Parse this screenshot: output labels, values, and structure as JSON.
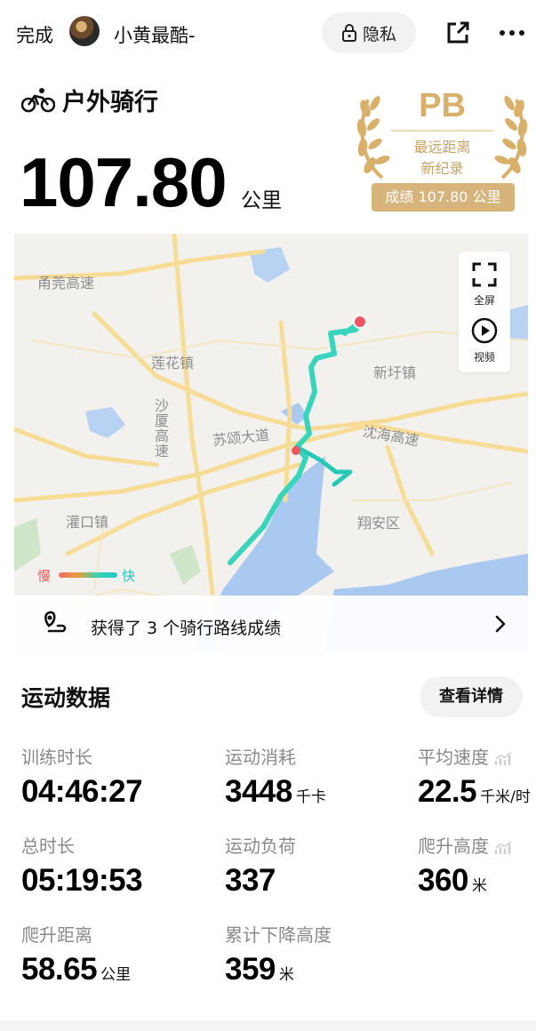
{
  "header": {
    "done_label": "完成",
    "username": "小黄最酷-",
    "privacy_label": "隐私",
    "share_icon": "share-icon",
    "more_icon": "more-icon"
  },
  "activity": {
    "sport_type": "户外骑行",
    "distance_value": "107.80",
    "distance_unit": "公里"
  },
  "pb_badge": {
    "title": "PB",
    "line1": "最远距离",
    "line2": "新纪录",
    "result": "成绩 107.80 公里",
    "color": "#d7b47c"
  },
  "map": {
    "labels": [
      "甬莞高速",
      "莲花镇",
      "新圩镇",
      "沙厦高速",
      "苏颂大道",
      "沈海高速",
      "灌口镇",
      "翔安区"
    ],
    "fullscreen_label": "全屏",
    "video_label": "视频",
    "legend_slow": "慢",
    "legend_fast": "快",
    "route_achievement": "获得了 3 个骑行路线成绩"
  },
  "stats": {
    "section_title": "运动数据",
    "details_button": "查看详情",
    "items": [
      {
        "label": "训练时长",
        "value": "04:46:27",
        "unit": ""
      },
      {
        "label": "运动消耗",
        "value": "3448",
        "unit": "千卡"
      },
      {
        "label": "平均速度",
        "value": "22.5",
        "unit": "千米/时"
      },
      {
        "label": "总时长",
        "value": "05:19:53",
        "unit": ""
      },
      {
        "label": "运动负荷",
        "value": "337",
        "unit": ""
      },
      {
        "label": "爬升高度",
        "value": "360",
        "unit": "米"
      },
      {
        "label": "爬升距离",
        "value": "58.65",
        "unit": "公里"
      },
      {
        "label": "累计下降高度",
        "value": "359",
        "unit": "米"
      }
    ]
  },
  "colors": {
    "route": "#2fd2b8",
    "water": "#a9c9f0",
    "road": "#f7dc96",
    "start_marker": "#f05561"
  }
}
